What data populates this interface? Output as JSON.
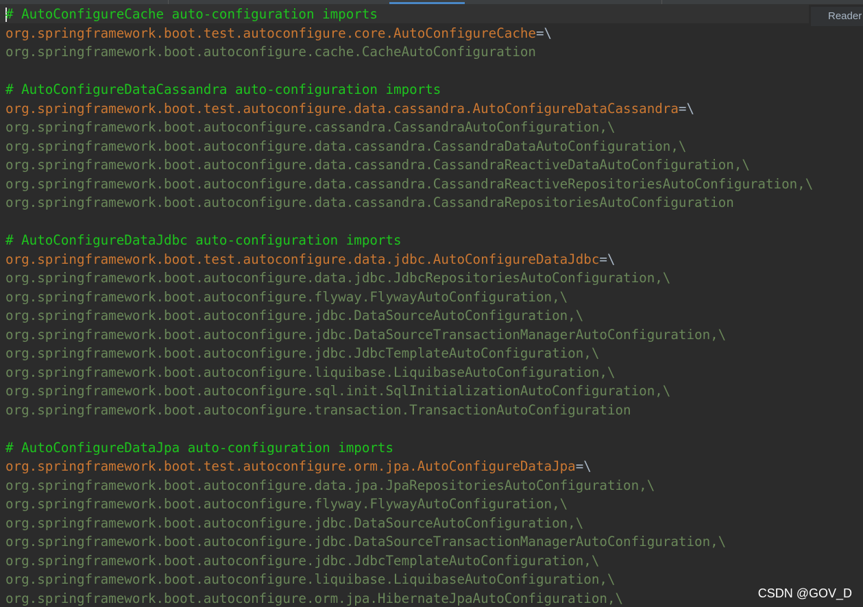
{
  "reader_mode_label": "Reader",
  "watermark": "CSDN @GOV_D",
  "colors": {
    "background": "#2b2b2b",
    "comment": "#1ec41e",
    "key": "#cc7832",
    "value": "#6a8759",
    "separator": "#a9b7c6",
    "tab_indicator": "#4a88c7"
  },
  "lines": [
    {
      "type": "comment",
      "text": "# AutoConfigureCache auto-configuration imports",
      "sep": ""
    },
    {
      "type": "key",
      "text": "org.springframework.boot.test.autoconfigure.core.AutoConfigureCache",
      "sep": "=\\"
    },
    {
      "type": "value",
      "text": "org.springframework.boot.autoconfigure.cache.CacheAutoConfiguration",
      "sep": ""
    },
    {
      "type": "blank",
      "text": "",
      "sep": ""
    },
    {
      "type": "comment",
      "text": "# AutoConfigureDataCassandra auto-configuration imports",
      "sep": ""
    },
    {
      "type": "key",
      "text": "org.springframework.boot.test.autoconfigure.data.cassandra.AutoConfigureDataCassandra",
      "sep": "=\\"
    },
    {
      "type": "value",
      "text": "org.springframework.boot.autoconfigure.cassandra.CassandraAutoConfiguration,\\",
      "sep": ""
    },
    {
      "type": "value",
      "text": "org.springframework.boot.autoconfigure.data.cassandra.CassandraDataAutoConfiguration,\\",
      "sep": ""
    },
    {
      "type": "value",
      "text": "org.springframework.boot.autoconfigure.data.cassandra.CassandraReactiveDataAutoConfiguration,\\",
      "sep": ""
    },
    {
      "type": "value",
      "text": "org.springframework.boot.autoconfigure.data.cassandra.CassandraReactiveRepositoriesAutoConfiguration,\\",
      "sep": ""
    },
    {
      "type": "value",
      "text": "org.springframework.boot.autoconfigure.data.cassandra.CassandraRepositoriesAutoConfiguration",
      "sep": ""
    },
    {
      "type": "blank",
      "text": "",
      "sep": ""
    },
    {
      "type": "comment",
      "text": "# AutoConfigureDataJdbc auto-configuration imports",
      "sep": ""
    },
    {
      "type": "key",
      "text": "org.springframework.boot.test.autoconfigure.data.jdbc.AutoConfigureDataJdbc",
      "sep": "=\\"
    },
    {
      "type": "value",
      "text": "org.springframework.boot.autoconfigure.data.jdbc.JdbcRepositoriesAutoConfiguration,\\",
      "sep": ""
    },
    {
      "type": "value",
      "text": "org.springframework.boot.autoconfigure.flyway.FlywayAutoConfiguration,\\",
      "sep": ""
    },
    {
      "type": "value",
      "text": "org.springframework.boot.autoconfigure.jdbc.DataSourceAutoConfiguration,\\",
      "sep": ""
    },
    {
      "type": "value",
      "text": "org.springframework.boot.autoconfigure.jdbc.DataSourceTransactionManagerAutoConfiguration,\\",
      "sep": ""
    },
    {
      "type": "value",
      "text": "org.springframework.boot.autoconfigure.jdbc.JdbcTemplateAutoConfiguration,\\",
      "sep": ""
    },
    {
      "type": "value",
      "text": "org.springframework.boot.autoconfigure.liquibase.LiquibaseAutoConfiguration,\\",
      "sep": ""
    },
    {
      "type": "value",
      "text": "org.springframework.boot.autoconfigure.sql.init.SqlInitializationAutoConfiguration,\\",
      "sep": ""
    },
    {
      "type": "value",
      "text": "org.springframework.boot.autoconfigure.transaction.TransactionAutoConfiguration",
      "sep": ""
    },
    {
      "type": "blank",
      "text": "",
      "sep": ""
    },
    {
      "type": "comment",
      "text": "# AutoConfigureDataJpa auto-configuration imports",
      "sep": ""
    },
    {
      "type": "key",
      "text": "org.springframework.boot.test.autoconfigure.orm.jpa.AutoConfigureDataJpa",
      "sep": "=\\"
    },
    {
      "type": "value",
      "text": "org.springframework.boot.autoconfigure.data.jpa.JpaRepositoriesAutoConfiguration,\\",
      "sep": ""
    },
    {
      "type": "value",
      "text": "org.springframework.boot.autoconfigure.flyway.FlywayAutoConfiguration,\\",
      "sep": ""
    },
    {
      "type": "value",
      "text": "org.springframework.boot.autoconfigure.jdbc.DataSourceAutoConfiguration,\\",
      "sep": ""
    },
    {
      "type": "value",
      "text": "org.springframework.boot.autoconfigure.jdbc.DataSourceTransactionManagerAutoConfiguration,\\",
      "sep": ""
    },
    {
      "type": "value",
      "text": "org.springframework.boot.autoconfigure.jdbc.JdbcTemplateAutoConfiguration,\\",
      "sep": ""
    },
    {
      "type": "value",
      "text": "org.springframework.boot.autoconfigure.liquibase.LiquibaseAutoConfiguration,\\",
      "sep": ""
    },
    {
      "type": "value",
      "text": "org.springframework.boot.autoconfigure.orm.jpa.HibernateJpaAutoConfiguration,\\",
      "sep": ""
    }
  ]
}
